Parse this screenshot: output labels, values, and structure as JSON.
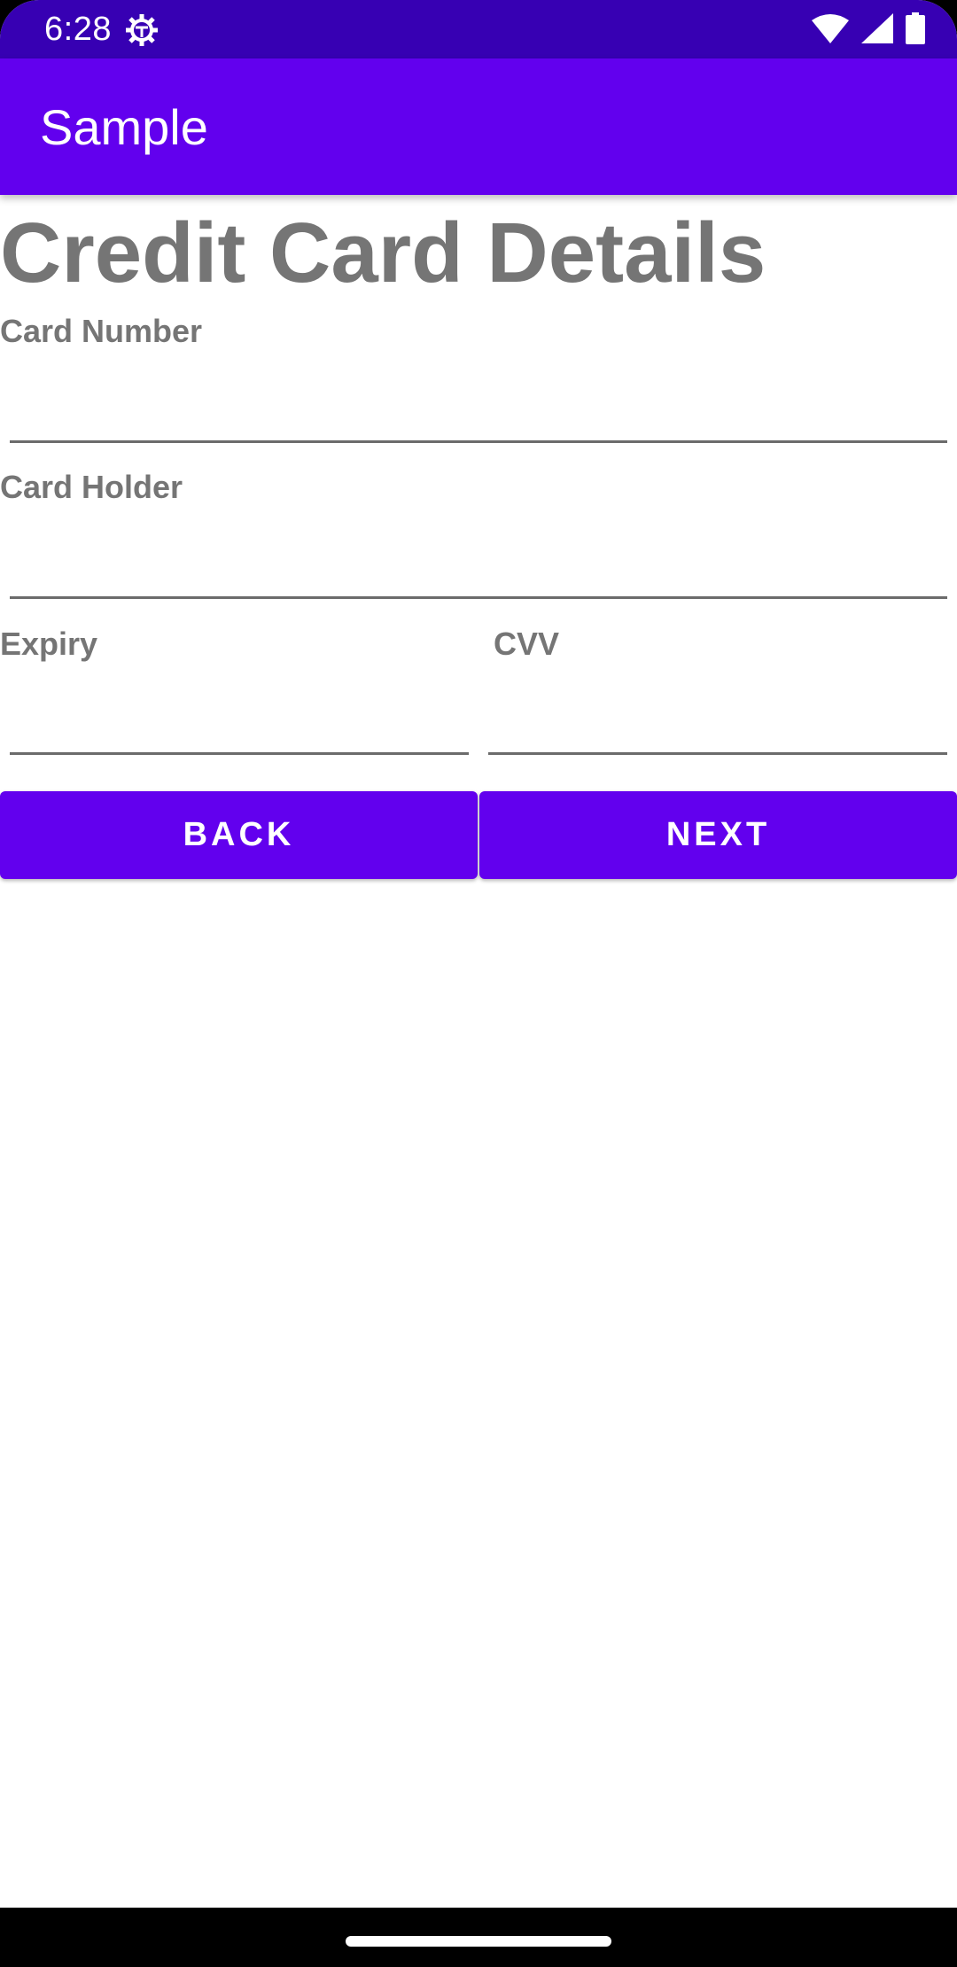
{
  "status_bar": {
    "time": "6:28",
    "icons": [
      "settings-gear-icon",
      "wifi-icon",
      "cellular-signal-icon",
      "battery-icon"
    ]
  },
  "app_bar": {
    "title": "Sample"
  },
  "form": {
    "title": "Credit Card Details",
    "card_number": {
      "label": "Card Number",
      "value": ""
    },
    "card_holder": {
      "label": "Card Holder",
      "value": ""
    },
    "expiry": {
      "label": "Expiry",
      "value": ""
    },
    "cvv": {
      "label": "CVV",
      "value": ""
    }
  },
  "buttons": {
    "back_label": "BACK",
    "next_label": "NEXT"
  },
  "colors": {
    "status_bar": "#3700b3",
    "primary": "#6200ee",
    "label_text": "#757575",
    "background": "#ffffff"
  }
}
